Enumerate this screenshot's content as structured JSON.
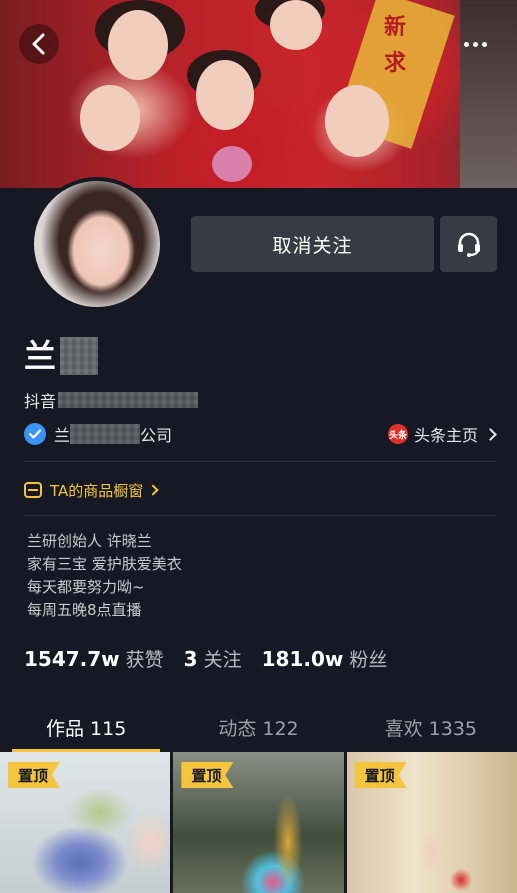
{
  "header": {
    "back_icon": "back-arrow-icon",
    "more_icon": "more-dots-icon",
    "cover_sash_text": "新 求"
  },
  "profile": {
    "name": "兰",
    "douyin_id_label": "抖音",
    "verified_text_prefix": "兰",
    "verified_text_suffix": "公司",
    "toutiao_logo_text": "头条",
    "toutiao_label": "头条主页"
  },
  "actions": {
    "unfollow_label": "取消关注",
    "message_icon": "headset-icon"
  },
  "shop": {
    "label": "TA的商品橱窗"
  },
  "bio": {
    "lines": [
      "兰研创始人 许晓兰",
      "家有三宝 爱护肤爱美衣",
      "每天都要努力呦~",
      "每周五晚8点直播"
    ]
  },
  "stats": {
    "likes_num": "1547.7w",
    "likes_label": "获赞",
    "following_num": "3",
    "following_label": "关注",
    "followers_num": "181.0w",
    "followers_label": "粉丝"
  },
  "tabs": [
    {
      "label": "作品 115",
      "active": true
    },
    {
      "label": "动态 122",
      "active": false
    },
    {
      "label": "喜欢 1335",
      "active": false
    }
  ],
  "videos": [
    {
      "pin_label": "置顶"
    },
    {
      "pin_label": "置顶"
    },
    {
      "pin_label": "置顶"
    }
  ],
  "colors": {
    "background": "#161823",
    "accent": "#f4c53c",
    "button": "#393b44",
    "verified": "#3b93f5"
  }
}
